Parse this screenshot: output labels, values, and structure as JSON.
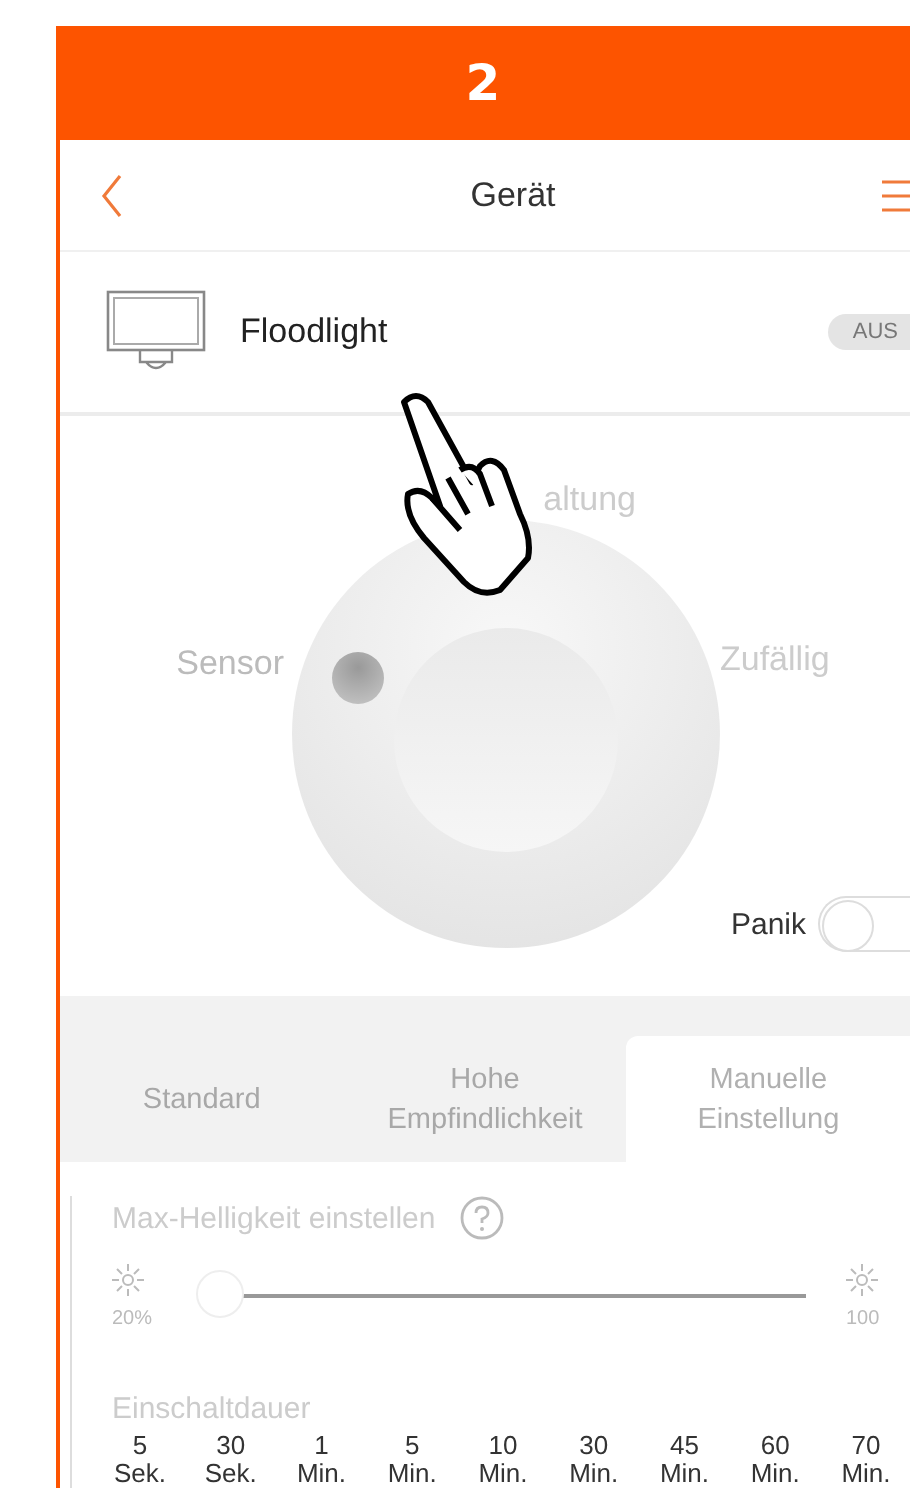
{
  "banner": {
    "step": "2"
  },
  "nav": {
    "title": "Gerät"
  },
  "device": {
    "name": "Floodlight",
    "switch": {
      "label": "AUS",
      "on": false
    }
  },
  "mode_panel": {
    "modes": [
      {
        "label": "altung",
        "selected": false
      },
      {
        "label": "Sensor",
        "selected": true
      },
      {
        "label": "Zufällig",
        "selected": false
      }
    ],
    "panic": {
      "label": "Panik",
      "on": false
    }
  },
  "tabs": [
    {
      "label": "Standard",
      "selected": false
    },
    {
      "label": "Hohe Empfindlichkeit",
      "selected": false
    },
    {
      "label": "Manuelle Einstellung",
      "selected": true
    }
  ],
  "brightness": {
    "title": "Max-Helligkeit einstellen",
    "min_label": "20%",
    "max_label": "100",
    "level": 0
  },
  "duration": {
    "title": "Einschaltdauer",
    "options": [
      {
        "value": "5",
        "unit": "Sek."
      },
      {
        "value": "30",
        "unit": "Sek."
      },
      {
        "value": "1",
        "unit": "Min."
      },
      {
        "value": "5",
        "unit": "Min."
      },
      {
        "value": "10",
        "unit": "Min."
      },
      {
        "value": "30",
        "unit": "Min."
      },
      {
        "value": "45",
        "unit": "Min."
      },
      {
        "value": "60",
        "unit": "Min."
      },
      {
        "value": "70",
        "unit": "Min."
      }
    ]
  }
}
